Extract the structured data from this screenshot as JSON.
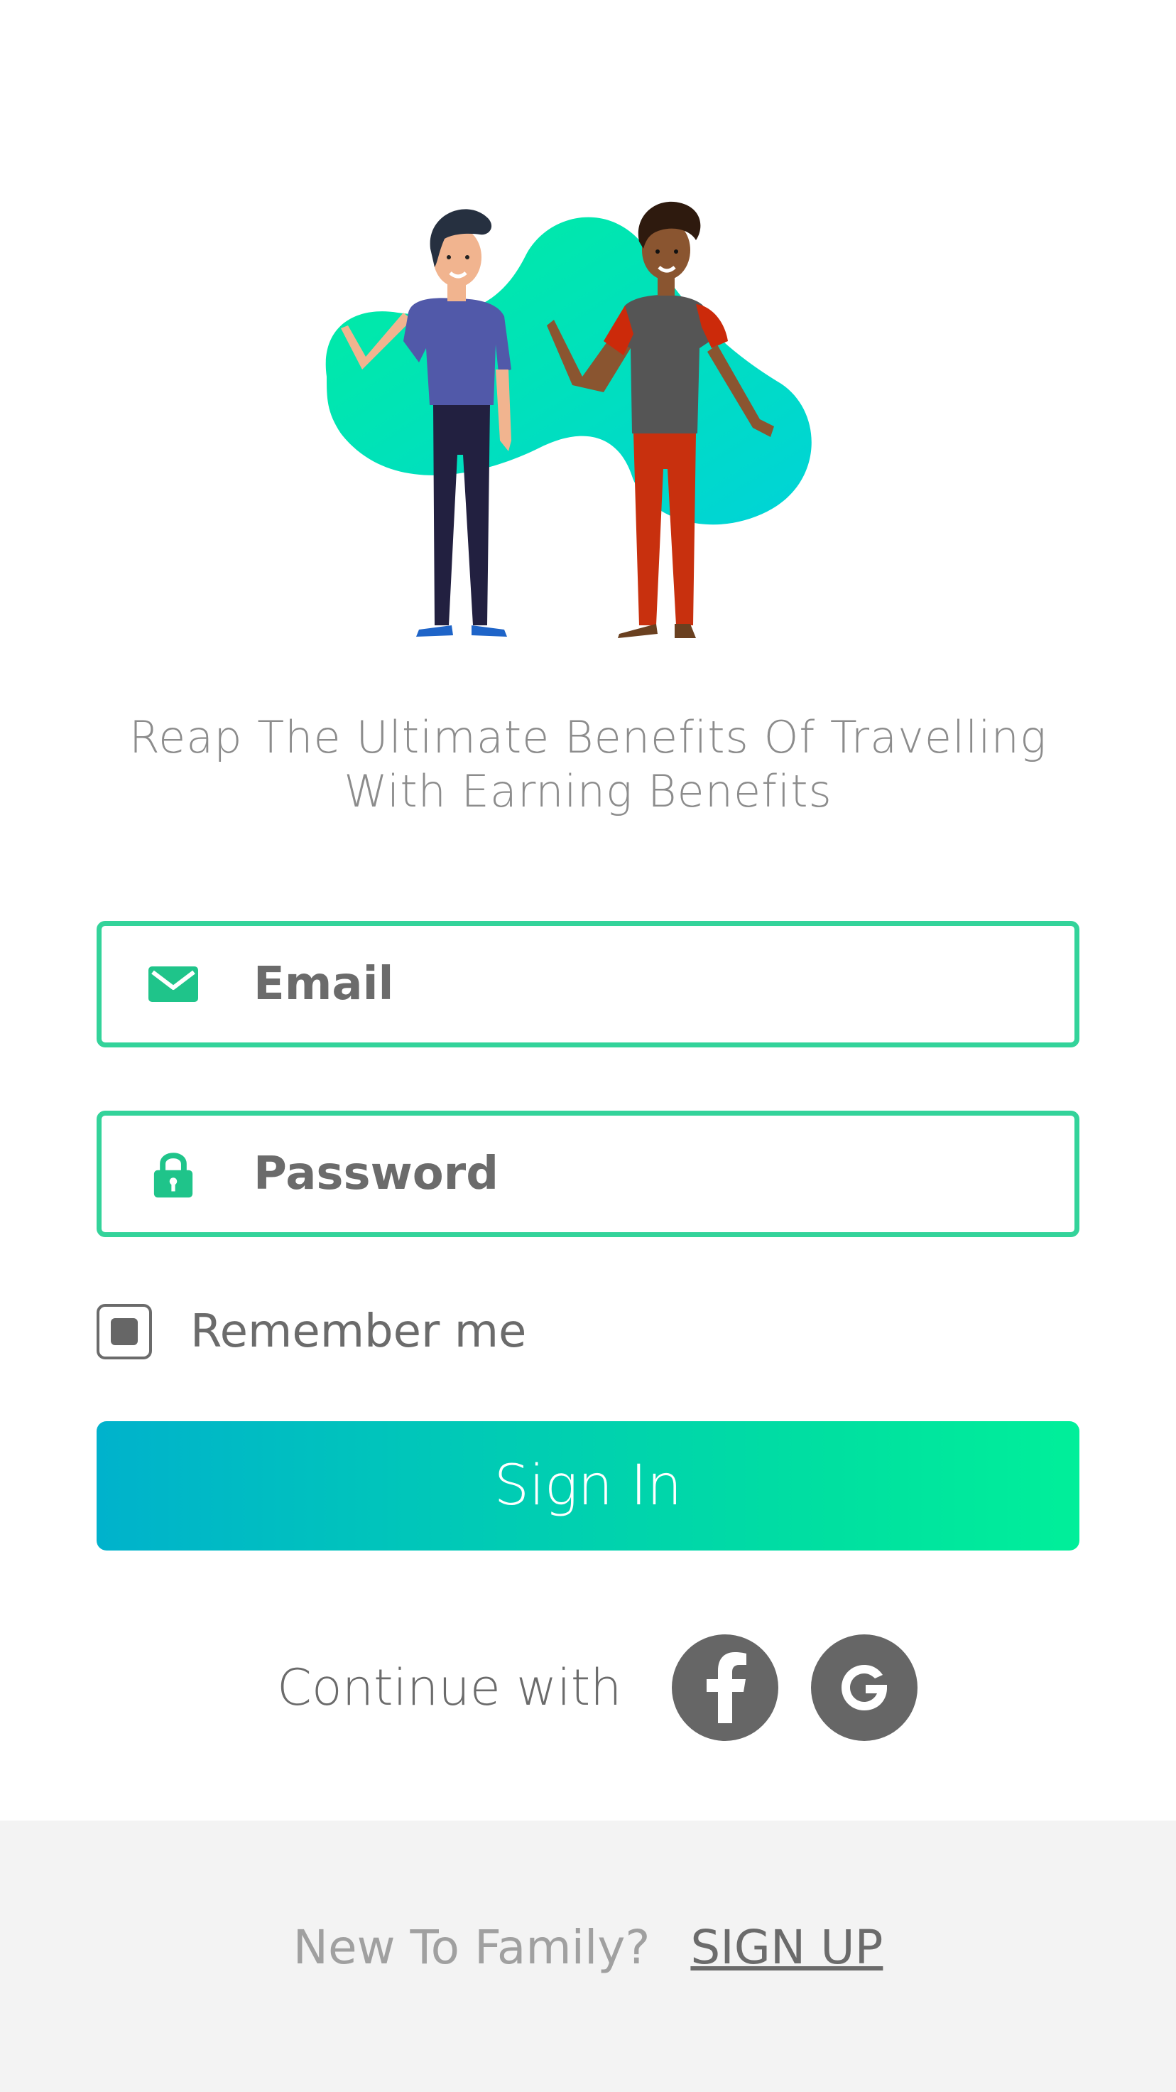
{
  "tagline": {
    "line1": "Reap The Ultimate Benefits  Of Travelling",
    "line2": "With Earning Benefits"
  },
  "form": {
    "email_placeholder": "Email",
    "password_placeholder": "Password",
    "remember_label": "Remember me",
    "remember_checked": true,
    "signin_label": "Sign In"
  },
  "social": {
    "continue_label": "Continue with",
    "facebook_icon": "facebook-icon",
    "google_icon": "google-icon"
  },
  "footer": {
    "question": "New To Family?",
    "signup_label": "SIGN UP"
  },
  "colors": {
    "accent_green": "#33d39a",
    "button_start": "#00b2cc",
    "button_end": "#00ef9a",
    "icon_gray": "#666666"
  }
}
